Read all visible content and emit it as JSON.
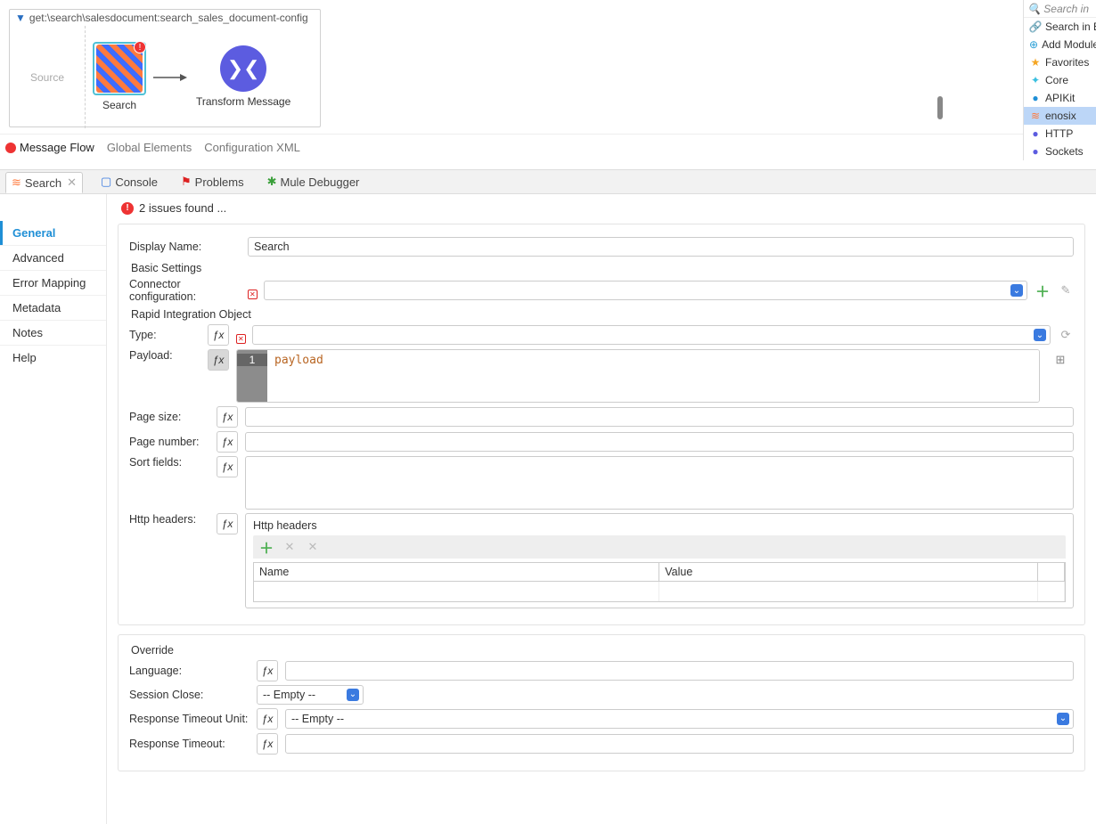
{
  "flow": {
    "title": "get:\\search\\salesdocument:search_sales_document-config",
    "source_label": "Source",
    "nodes": {
      "search": "Search",
      "transform": "Transform Message"
    }
  },
  "bottom_tabs": {
    "message_flow": "Message Flow",
    "global_elements": "Global Elements",
    "config_xml": "Configuration XML"
  },
  "lower_tabs": {
    "search": "Search",
    "console": "Console",
    "problems": "Problems",
    "mule_debugger": "Mule Debugger"
  },
  "side_nav": [
    "General",
    "Advanced",
    "Error Mapping",
    "Metadata",
    "Notes",
    "Help"
  ],
  "issues_text": "2 issues found ...",
  "props": {
    "display_name_label": "Display Name:",
    "display_name_value": "Search",
    "basic_settings": "Basic Settings",
    "connector_config_label": "Connector configuration:",
    "connector_config_value": "",
    "rio_label": "Rapid Integration Object",
    "type_label": "Type:",
    "type_value": "",
    "payload_label": "Payload:",
    "payload_code": "payload",
    "page_size_label": "Page size:",
    "page_number_label": "Page number:",
    "sort_fields_label": "Sort fields:",
    "http_headers_label": "Http headers:",
    "http_headers_inner": "Http headers",
    "col_name": "Name",
    "col_value": "Value",
    "override": "Override",
    "language_label": "Language:",
    "session_close_label": "Session Close:",
    "session_close_value": "-- Empty --",
    "rtu_label": "Response Timeout Unit:",
    "rtu_value": "-- Empty --",
    "rt_label": "Response Timeout:"
  },
  "palette": {
    "search_placeholder": "Search in",
    "items": [
      {
        "label": "Search in E",
        "icon": "🔗",
        "color": "#2a6fc2"
      },
      {
        "label": "Add Module",
        "icon": "⊕",
        "color": "#2a9fd6"
      },
      {
        "label": "Favorites",
        "icon": "★",
        "color": "#f5a623"
      },
      {
        "label": "Core",
        "icon": "✦",
        "color": "#39bfe0"
      },
      {
        "label": "APIKit",
        "icon": "●",
        "color": "#1f8fd6"
      },
      {
        "label": "enosix",
        "icon": "≋",
        "color": "#ff7a3d"
      },
      {
        "label": "HTTP",
        "icon": "●",
        "color": "#5c5ce0"
      },
      {
        "label": "Sockets",
        "icon": "●",
        "color": "#5c5ce0"
      }
    ]
  }
}
